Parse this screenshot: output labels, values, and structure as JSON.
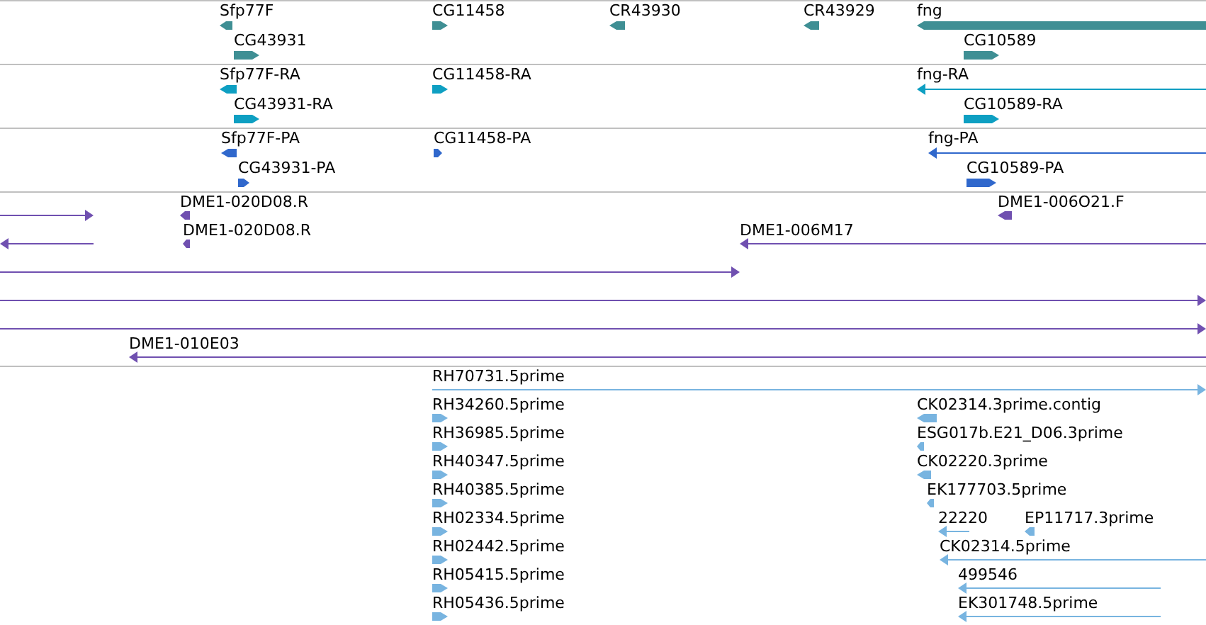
{
  "tracks": [
    {
      "kind": "gene",
      "color": "#3f8f94",
      "features": [
        {
          "label": "Sfp77F",
          "reverse": true
        },
        {
          "label": "CG43931",
          "reverse": false
        },
        {
          "label": "CG11458",
          "reverse": false
        },
        {
          "label": "CR43930",
          "reverse": true
        },
        {
          "label": "CR43929",
          "reverse": true
        },
        {
          "label": "fng",
          "reverse": true
        },
        {
          "label": "CG10589",
          "reverse": false
        }
      ]
    },
    {
      "kind": "transcript",
      "color": "#0e9fc2",
      "features": [
        {
          "label": "Sfp77F-RA",
          "reverse": true
        },
        {
          "label": "CG43931-RA",
          "reverse": false
        },
        {
          "label": "CG11458-RA",
          "reverse": false
        },
        {
          "label": "fng-RA",
          "reverse": true
        },
        {
          "label": "CG10589-RA",
          "reverse": false
        }
      ]
    },
    {
      "kind": "transcript",
      "color": "#3068cc",
      "features": [
        {
          "label": "Sfp77F-PA",
          "reverse": true
        },
        {
          "label": "CG43931-PA",
          "reverse": false
        },
        {
          "label": "CG11458-PA",
          "reverse": false
        },
        {
          "label": "fng-PA",
          "reverse": true
        },
        {
          "label": "CG10589-PA",
          "reverse": false
        }
      ]
    },
    {
      "kind": "clone",
      "color": "#7050b0",
      "features": [
        {
          "reverse": false
        },
        {
          "label": "DME1-020D08.R",
          "reverse": true
        },
        {
          "label": "DME1-006O21.F",
          "reverse": true
        },
        {
          "reverse": true
        },
        {
          "label": "DME1-020D08.R",
          "reverse": true
        },
        {
          "label": "DME1-006M17",
          "reverse": true
        },
        {
          "reverse": false
        },
        {
          "reverse": false
        },
        {
          "reverse": false
        },
        {
          "label": "DME1-010E03",
          "reverse": true
        }
      ]
    },
    {
      "kind": "est",
      "color": "#78b4e0",
      "features": [
        {
          "label": "RH70731.5prime",
          "reverse": false
        },
        {
          "label": "RH34260.5prime",
          "reverse": false
        },
        {
          "label": "CK02314.3prime.contig",
          "reverse": true
        },
        {
          "label": "RH36985.5prime",
          "reverse": false
        },
        {
          "label": "ESG017b.E21_D06.3prime",
          "reverse": true
        },
        {
          "label": "RH40347.5prime",
          "reverse": false
        },
        {
          "label": "CK02220.3prime",
          "reverse": true
        },
        {
          "label": "RH40385.5prime",
          "reverse": false
        },
        {
          "label": "EK177703.5prime",
          "reverse": true
        },
        {
          "label": "RH02334.5prime",
          "reverse": false
        },
        {
          "label": "22220",
          "reverse": true
        },
        {
          "label": "EP11717.3prime",
          "reverse": true
        },
        {
          "label": "RH02442.5prime",
          "reverse": false
        },
        {
          "label": "CK02314.5prime",
          "reverse": true
        },
        {
          "label": "RH05415.5prime",
          "reverse": false
        },
        {
          "label": "499546",
          "reverse": true
        },
        {
          "label": "RH05436.5prime",
          "reverse": false
        },
        {
          "label": "EK301748.5prime",
          "reverse": true
        }
      ]
    }
  ]
}
